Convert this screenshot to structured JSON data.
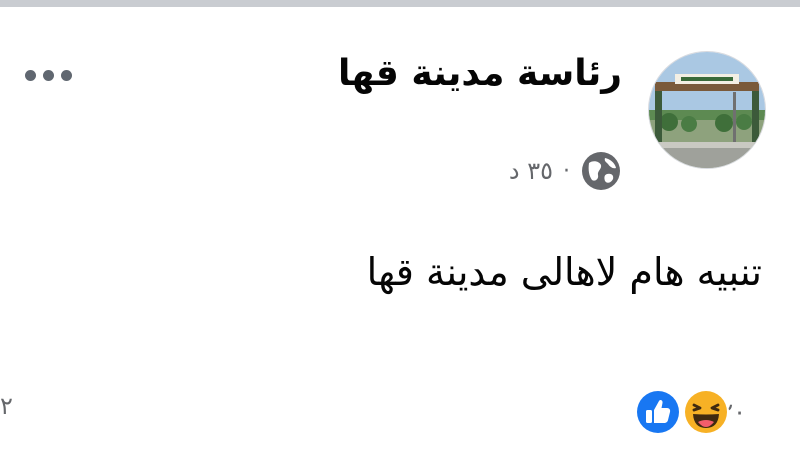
{
  "post": {
    "author": "رئاسة مدينة قها",
    "time": "٣٥ د",
    "separator": "·",
    "audience_icon": "globe-icon",
    "more_icon": "more-options-icon",
    "text": "تنبيه هام لاهالى مدينة قها",
    "reactions": {
      "icons": [
        "like-icon",
        "haha-icon"
      ],
      "count": "٢٠"
    },
    "comments_count": "٢"
  },
  "colors": {
    "like_blue": "#1877f2",
    "haha_yellow": "#f7b125",
    "secondary_text": "#65676b",
    "primary_text": "#050505",
    "top_bar": "#c9ccd1"
  }
}
